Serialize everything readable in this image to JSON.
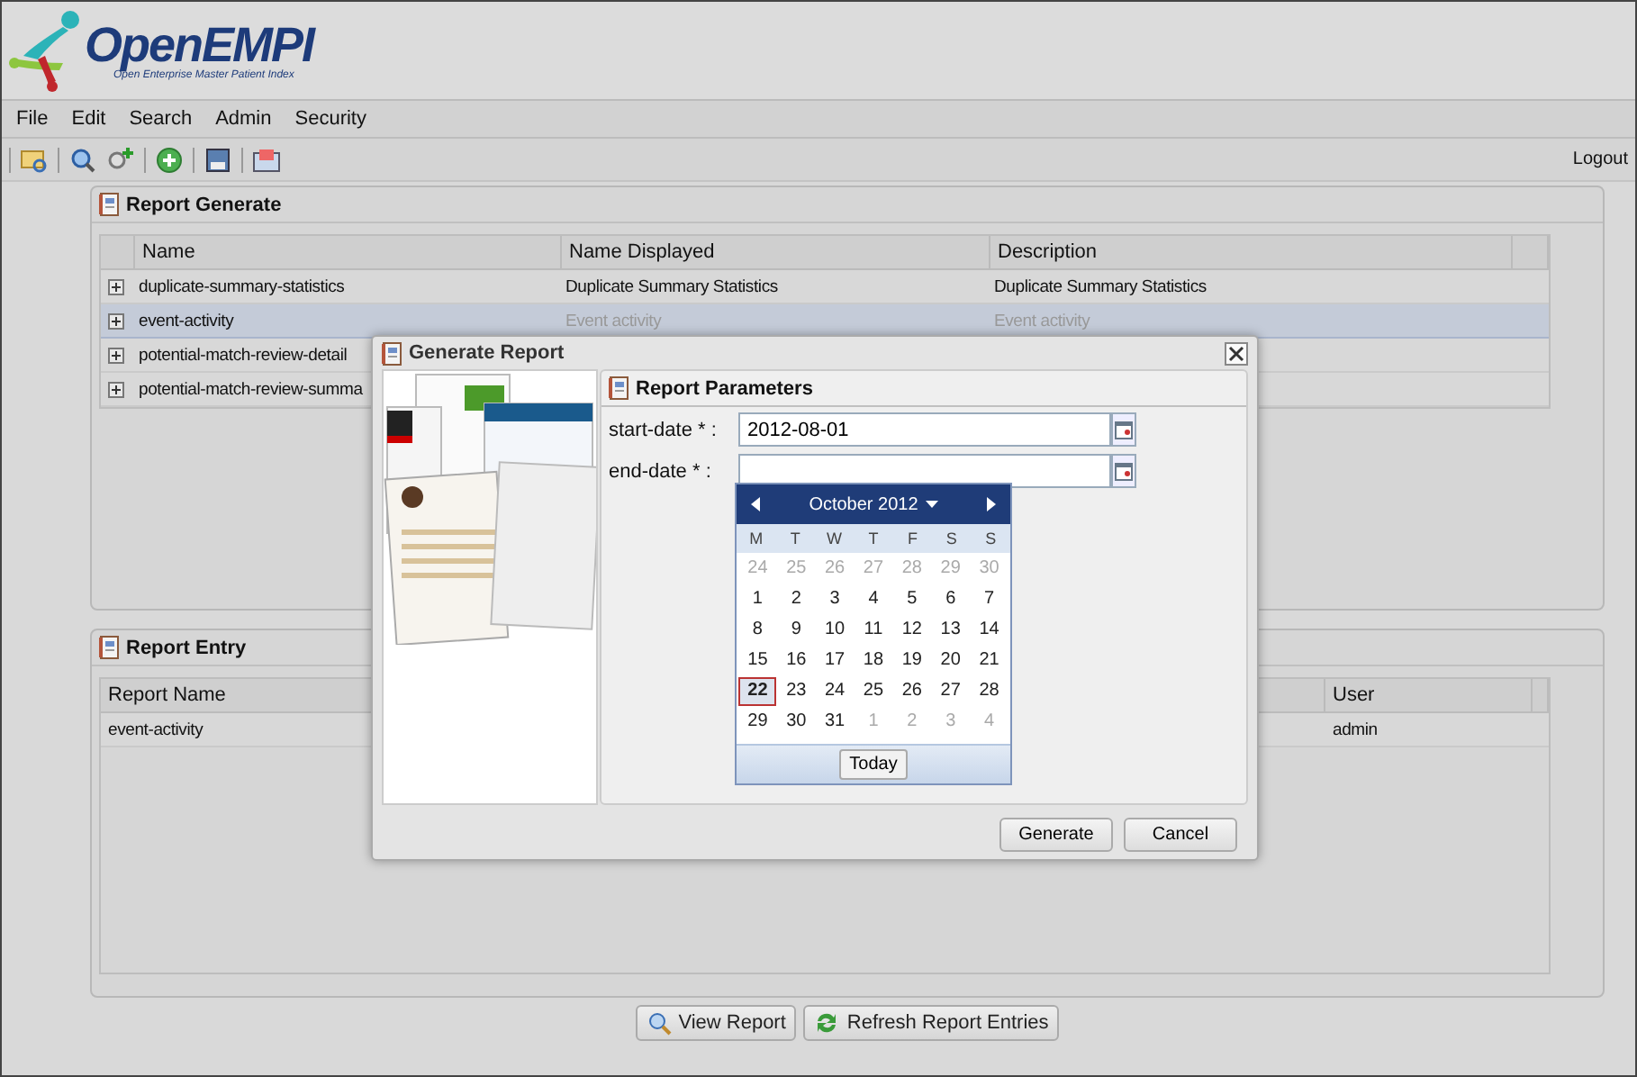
{
  "logo": {
    "name": "OpenEMPI",
    "tagline": "Open Enterprise Master Patient Index"
  },
  "menu": [
    "File",
    "Edit",
    "Search",
    "Admin",
    "Security"
  ],
  "toolbar": {
    "logout": "Logout"
  },
  "report_generate": {
    "title": "Report Generate",
    "columns": [
      "Name",
      "Name Displayed",
      "Description"
    ],
    "rows": [
      {
        "cells": [
          "duplicate-summary-statistics",
          "Duplicate Summary Statistics",
          "Duplicate Summary Statistics"
        ],
        "selected": false
      },
      {
        "cells": [
          "event-activity",
          "Event activity",
          "Event activity"
        ],
        "selected": true
      },
      {
        "cells": [
          "potential-match-review-detail"
        ],
        "selected": false
      },
      {
        "cells": [
          "potential-match-review-summa"
        ],
        "selected": false
      }
    ]
  },
  "report_entry": {
    "title": "Report Entry",
    "columns": [
      "Report Name",
      "User"
    ],
    "rows": [
      {
        "cells": [
          "event-activity",
          "admin"
        ]
      }
    ]
  },
  "buttons": [
    "View Report",
    "Refresh Report Entries"
  ],
  "dialog": {
    "title": "Generate Report",
    "panel_title": "Report Parameters",
    "fields": [
      {
        "label": "start-date * :",
        "value": "2012-08-01"
      },
      {
        "label": "end-date * :"
      }
    ],
    "calendar": {
      "month": "October 2012",
      "weekdays": [
        "M",
        "T",
        "W",
        "T",
        "F",
        "S",
        "S"
      ],
      "weeks": [
        [
          {
            "day": "24",
            "in_month": false,
            "selected": false
          },
          {
            "day": "25",
            "in_month": false,
            "selected": false
          },
          {
            "day": "26",
            "in_month": false,
            "selected": false
          },
          {
            "day": "27",
            "in_month": false,
            "selected": false
          },
          {
            "day": "28",
            "in_month": false,
            "selected": false
          },
          {
            "day": "29",
            "in_month": false,
            "selected": false
          },
          {
            "day": "30",
            "in_month": false,
            "selected": false
          }
        ],
        [
          {
            "day": "1",
            "in_month": true,
            "selected": false
          },
          {
            "day": "2",
            "in_month": true,
            "selected": false
          },
          {
            "day": "3",
            "in_month": true,
            "selected": false
          },
          {
            "day": "4",
            "in_month": true,
            "selected": false
          },
          {
            "day": "5",
            "in_month": true,
            "selected": false
          },
          {
            "day": "6",
            "in_month": true,
            "selected": false
          },
          {
            "day": "7",
            "in_month": true,
            "selected": false
          }
        ],
        [
          {
            "day": "8",
            "in_month": true,
            "selected": false
          },
          {
            "day": "9",
            "in_month": true,
            "selected": false
          },
          {
            "day": "10",
            "in_month": true,
            "selected": false
          },
          {
            "day": "11",
            "in_month": true,
            "selected": false
          },
          {
            "day": "12",
            "in_month": true,
            "selected": false
          },
          {
            "day": "13",
            "in_month": true,
            "selected": false
          },
          {
            "day": "14",
            "in_month": true,
            "selected": false
          }
        ],
        [
          {
            "day": "15",
            "in_month": true,
            "selected": false
          },
          {
            "day": "16",
            "in_month": true,
            "selected": false
          },
          {
            "day": "17",
            "in_month": true,
            "selected": false
          },
          {
            "day": "18",
            "in_month": true,
            "selected": false
          },
          {
            "day": "19",
            "in_month": true,
            "selected": false
          },
          {
            "day": "20",
            "in_month": true,
            "selected": false
          },
          {
            "day": "21",
            "in_month": true,
            "selected": false
          }
        ],
        [
          {
            "day": "22",
            "in_month": true,
            "selected": true
          },
          {
            "day": "23",
            "in_month": true,
            "selected": false
          },
          {
            "day": "24",
            "in_month": true,
            "selected": false
          },
          {
            "day": "25",
            "in_month": true,
            "selected": false
          },
          {
            "day": "26",
            "in_month": true,
            "selected": false
          },
          {
            "day": "27",
            "in_month": true,
            "selected": false
          },
          {
            "day": "28",
            "in_month": true,
            "selected": false
          }
        ],
        [
          {
            "day": "29",
            "in_month": true,
            "selected": false
          },
          {
            "day": "30",
            "in_month": true,
            "selected": false
          },
          {
            "day": "31",
            "in_month": true,
            "selected": false
          },
          {
            "day": "1",
            "in_month": false,
            "selected": false
          },
          {
            "day": "2",
            "in_month": false,
            "selected": false
          },
          {
            "day": "3",
            "in_month": false,
            "selected": false
          },
          {
            "day": "4",
            "in_month": false,
            "selected": false
          }
        ]
      ],
      "today": "Today"
    },
    "buttons": [
      "Generate",
      "Cancel"
    ]
  }
}
